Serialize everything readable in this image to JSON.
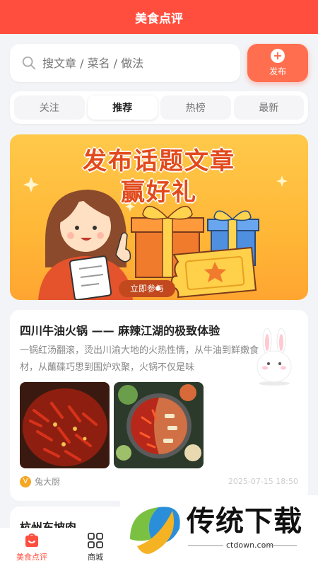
{
  "header": {
    "title": "美食点评"
  },
  "search": {
    "placeholder": "搜文章 / 菜名 / 做法",
    "icon": "search-icon"
  },
  "publish": {
    "label": "发布",
    "icon": "plus-icon"
  },
  "tabs": [
    {
      "label": "关注",
      "active": false
    },
    {
      "label": "推荐",
      "active": true
    },
    {
      "label": "热榜",
      "active": false
    },
    {
      "label": "最新",
      "active": false
    }
  ],
  "banner": {
    "line1": "发布话题文章",
    "line2": "赢好礼",
    "cta": "立即参与"
  },
  "article": {
    "title": "四川牛油火锅 —— 麻辣江湖的极致体验",
    "desc": "一锅红汤翻滚，烫出川渝大地的火热性情，从牛油到鲜嫩食材，从蘸碟巧思到围炉欢聚，火锅不仅是味",
    "author": "兔大厨",
    "date": "2025-07-15 18:50"
  },
  "article2": {
    "title": "杭州东坡肉"
  },
  "nav": [
    {
      "label": "美食点评",
      "active": true,
      "icon": "home-icon"
    },
    {
      "label": "商城",
      "active": false,
      "icon": "grid-icon"
    }
  ],
  "watermark": {
    "text": "传统下载",
    "sub": "ctdown.com"
  },
  "colors": {
    "primary": "#ff4e3e",
    "accent": "#ff6f4f",
    "banner": "#ffb737"
  }
}
